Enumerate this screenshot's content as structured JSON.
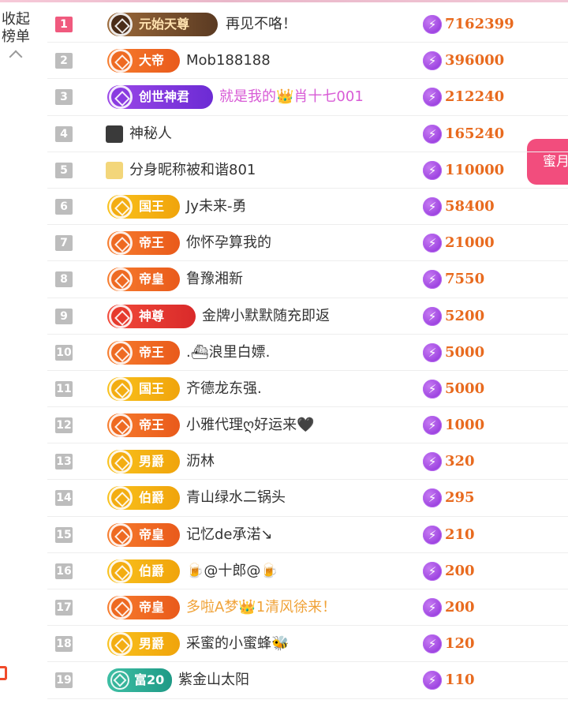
{
  "sidebar": {
    "collapse_label": "收起榜单",
    "side_button_label": "蜜月"
  },
  "rows": [
    {
      "rank": "1",
      "badge": "元始天尊",
      "badge_style": "dark",
      "name": "再见不咯！",
      "name_color": "default",
      "amount": "7162399"
    },
    {
      "rank": "2",
      "badge": "大帝",
      "badge_style": "orange",
      "name": "Mob188188",
      "name_color": "default",
      "amount": "396000"
    },
    {
      "rank": "3",
      "badge": "创世神君",
      "badge_style": "purple",
      "name": "就是我的👑肖十七001",
      "name_color": "pink",
      "amount": "212240"
    },
    {
      "rank": "4",
      "badge": "",
      "badge_style": "avatar-dark",
      "name": "神秘人",
      "name_color": "default",
      "amount": "165240"
    },
    {
      "rank": "5",
      "badge": "",
      "badge_style": "avatar-y",
      "name": "分身昵称被和谐801",
      "name_color": "default",
      "amount": "110000"
    },
    {
      "rank": "6",
      "badge": "国王",
      "badge_style": "gold",
      "name": "Jy未来-勇",
      "name_color": "default",
      "amount": "58400"
    },
    {
      "rank": "7",
      "badge": "帝王",
      "badge_style": "orange",
      "name": "你怀孕算我的",
      "name_color": "default",
      "amount": "21000"
    },
    {
      "rank": "8",
      "badge": "帝皇",
      "badge_style": "orange",
      "name": "鲁豫湘新",
      "name_color": "default",
      "amount": "7550"
    },
    {
      "rank": "9",
      "badge": "神尊",
      "badge_style": "red",
      "name": "金牌小默默随充即返",
      "name_color": "default",
      "amount": "5200"
    },
    {
      "rank": "10",
      "badge": "帝王",
      "badge_style": "orange",
      "name": ".⛴浪里白嫖.",
      "name_color": "default",
      "amount": "5000"
    },
    {
      "rank": "11",
      "badge": "国王",
      "badge_style": "gold",
      "name": "齐德龙东强.",
      "name_color": "default",
      "amount": "5000"
    },
    {
      "rank": "12",
      "badge": "帝王",
      "badge_style": "orange",
      "name": "小雅代理ღ好运来🖤",
      "name_color": "default",
      "amount": "1000"
    },
    {
      "rank": "13",
      "badge": "男爵",
      "badge_style": "gold",
      "name": "沥林",
      "name_color": "default",
      "amount": "320"
    },
    {
      "rank": "14",
      "badge": "伯爵",
      "badge_style": "gold",
      "name": "青山绿水二锅头",
      "name_color": "default",
      "amount": "295"
    },
    {
      "rank": "15",
      "badge": "帝皇",
      "badge_style": "orange",
      "name": "记忆de承渃↘",
      "name_color": "default",
      "amount": "210"
    },
    {
      "rank": "16",
      "badge": "伯爵",
      "badge_style": "gold",
      "name": "🍺@十郎@🍺",
      "name_color": "default",
      "amount": "200"
    },
    {
      "rank": "17",
      "badge": "帝皇",
      "badge_style": "orange",
      "name": "多啦A梦👑1清风徐来！",
      "name_color": "orange",
      "amount": "200"
    },
    {
      "rank": "18",
      "badge": "男爵",
      "badge_style": "gold",
      "name": "采蜜的小蜜蜂🐝",
      "name_color": "default",
      "amount": "120"
    },
    {
      "rank": "19",
      "badge": "富20",
      "badge_style": "wealth",
      "name": "紫金山太阳",
      "name_color": "default",
      "amount": "110"
    }
  ],
  "coin_glyph": "⚡",
  "colors": {
    "amount": "#e86a1e",
    "coin": "#8a2bd8",
    "rank1": "#f05a7e",
    "rank_default": "#bdbdbd",
    "side_button": "#f24d7d"
  }
}
